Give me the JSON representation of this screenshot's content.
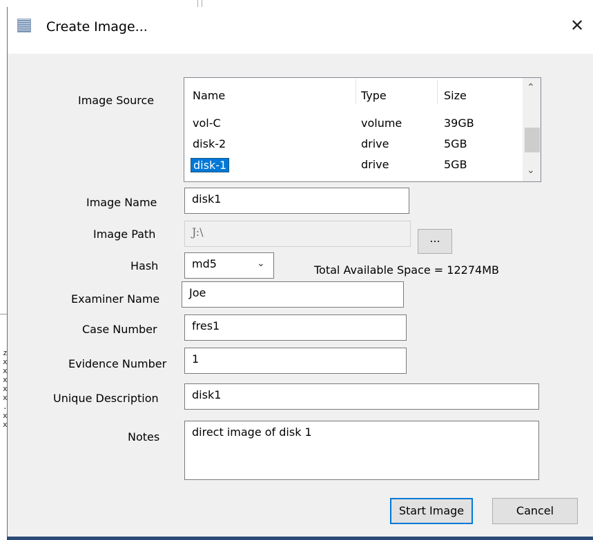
{
  "background": {
    "side_marks": [
      "z",
      "x",
      "x",
      "x",
      "x",
      "x",
      ".",
      "x",
      "x"
    ]
  },
  "dialog": {
    "title": "Create Image...",
    "close_icon": "close-icon",
    "app_icon": "app-icon"
  },
  "image_source": {
    "label": "Image Source",
    "columns": [
      "Name",
      "Type",
      "Size"
    ],
    "rows": [
      {
        "name": "vol-C",
        "type": "volume",
        "size": "39GB"
      },
      {
        "name": "disk-2",
        "type": "drive",
        "size": "5GB"
      },
      {
        "name": "disk-1",
        "type": "drive",
        "size": "5GB",
        "selected": true
      }
    ]
  },
  "image_name": {
    "label": "Image Name",
    "value": "disk1"
  },
  "image_path": {
    "label": "Image Path",
    "value": "J:\\",
    "browse_label": "..."
  },
  "hash": {
    "label": "Hash",
    "value": "md5",
    "available_space": "Total Available Space = 12274MB"
  },
  "examiner_name": {
    "label": "Examiner Name",
    "value": "Joe"
  },
  "case_number": {
    "label": "Case Number",
    "value": "fres1"
  },
  "evidence_number": {
    "label": "Evidence Number",
    "value": "1"
  },
  "unique_description": {
    "label": "Unique Description",
    "value": "disk1"
  },
  "notes": {
    "label": "Notes",
    "value": "direct image of disk 1"
  },
  "buttons": {
    "start": "Start Image",
    "cancel": "Cancel"
  },
  "colors": {
    "selection": "#0078d7",
    "dialog_bg": "#f0f0f0"
  }
}
